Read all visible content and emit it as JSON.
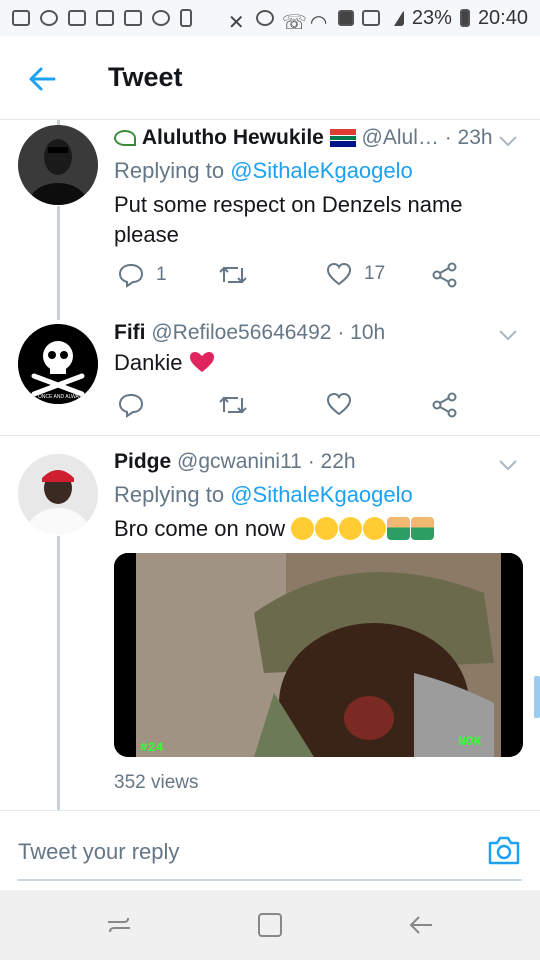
{
  "status_bar": {
    "battery": "23%",
    "time": "20:40"
  },
  "app_bar": {
    "title": "Tweet"
  },
  "tweets": [
    {
      "name": "Alulutho Hewukile",
      "handle": "@Alul…",
      "time": "· 23h",
      "reply_prefix": "Replying to ",
      "reply_to": "@SithaleKgaogelo",
      "text": "Put some respect on Denzels name please",
      "replies": "1",
      "retweets": "",
      "likes": "17"
    },
    {
      "name": "Fifi",
      "handle": "@Refiloe56646492",
      "time": "· 10h",
      "text": "Dankie",
      "replies": "",
      "retweets": "",
      "likes": ""
    },
    {
      "name": "Pidge",
      "handle": "@gcwanini11",
      "time": "· 22h",
      "reply_prefix": "Replying to ",
      "reply_to": "@SithaleKgaogelo",
      "text": "Bro come on now",
      "video_tag_left": "#24",
      "video_tag_right": "NOK",
      "views": "352 views"
    }
  ],
  "reply_bar": {
    "placeholder": "Tweet your reply"
  },
  "avatar_labels": {
    "fifi": "ONCE AND ALWAYS"
  },
  "colors": {
    "accent": "#1da1f2",
    "heart": "#e0245e"
  }
}
